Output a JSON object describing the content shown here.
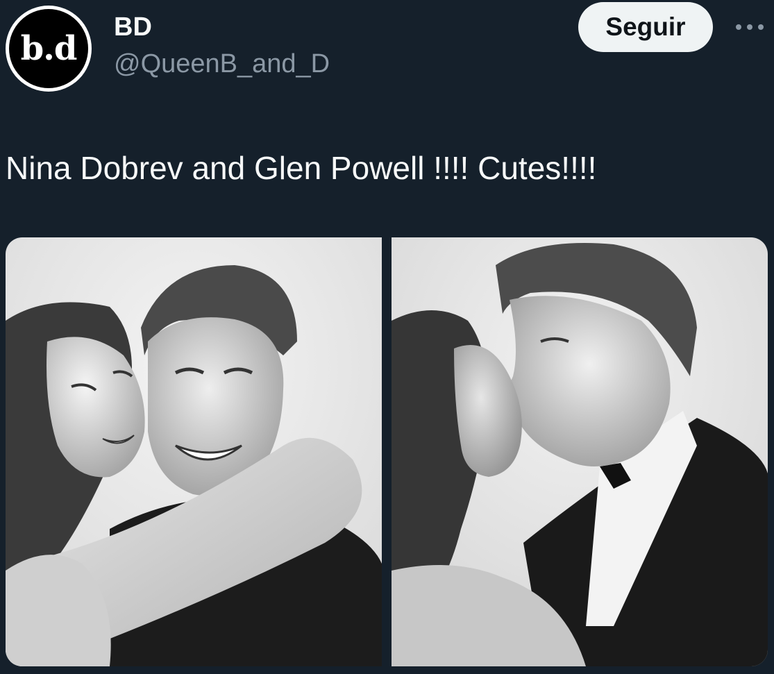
{
  "author": {
    "avatar_text": "b.d",
    "display_name": "BD",
    "handle": "@QueenB_and_D"
  },
  "actions": {
    "follow_label": "Seguir",
    "more_icon": "more-horizontal-icon"
  },
  "tweet": {
    "text": "Nina Dobrev and Glen Powell !!!! Cutes!!!!"
  },
  "media": {
    "photos": [
      {
        "kind": "black-and-white photo booth picture"
      },
      {
        "kind": "black-and-white photo booth picture"
      }
    ]
  },
  "colors": {
    "background": "#15202b",
    "primary_text": "#f7f9f9",
    "secondary_text": "#8b98a5",
    "follow_button_bg": "#eff3f4",
    "follow_button_text": "#0f1419"
  }
}
